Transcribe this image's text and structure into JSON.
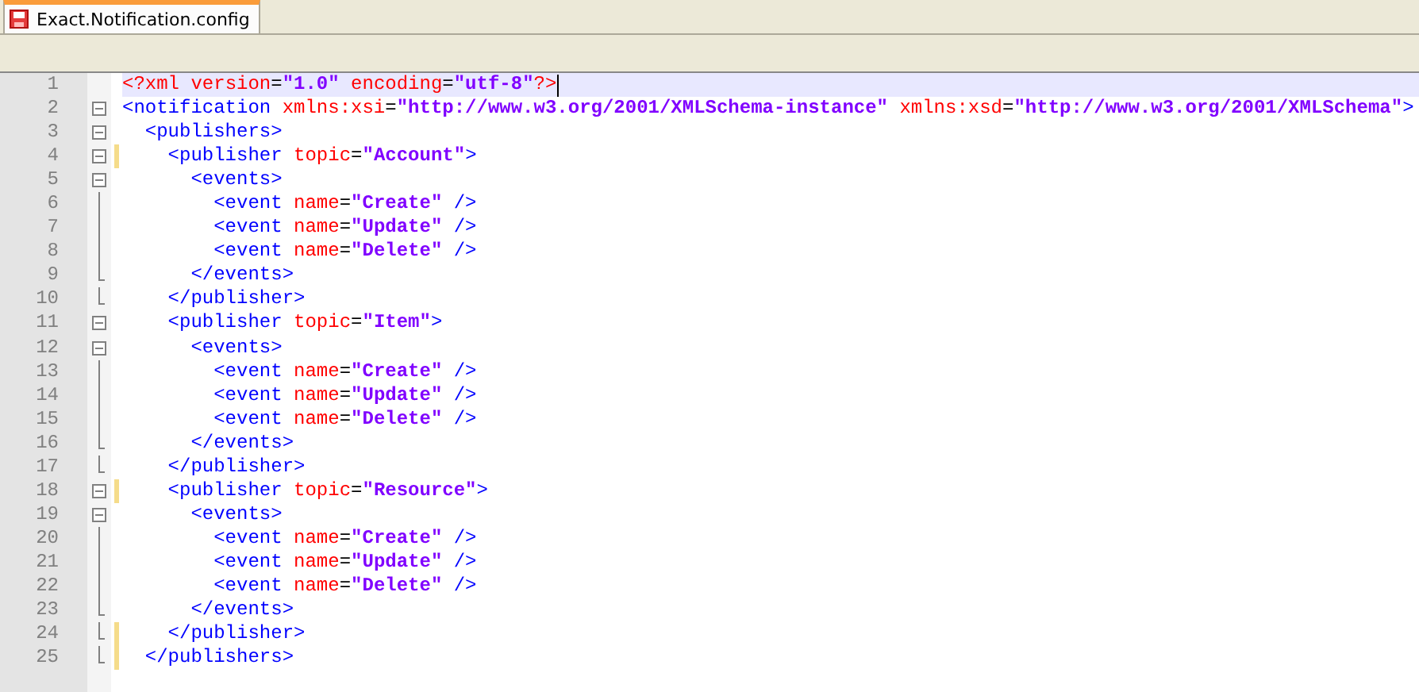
{
  "tabs": [
    {
      "label": "Exact.Notification.config",
      "selected": true
    }
  ],
  "lines": [
    {
      "number": "1",
      "kind": "plain",
      "changed": false,
      "current": true,
      "tokens": [
        {
          "kind": "decl",
          "text": "<?xml"
        },
        {
          "kind": "attr",
          "text": " version"
        },
        {
          "kind": "eq",
          "text": "="
        },
        {
          "kind": "value",
          "text": "\"1.0\""
        },
        {
          "kind": "attr",
          "text": " encoding"
        },
        {
          "kind": "eq",
          "text": "="
        },
        {
          "kind": "value",
          "text": "\"utf-8\""
        },
        {
          "kind": "decl",
          "text": "?>"
        }
      ]
    },
    {
      "number": "2",
      "kind": "fold_open",
      "changed": false,
      "current": false,
      "tokens": [
        {
          "kind": "tag",
          "text": "<notification"
        },
        {
          "kind": "attr",
          "text": " xmlns:xsi"
        },
        {
          "kind": "eq",
          "text": "="
        },
        {
          "kind": "value",
          "text": "\"http://www.w3.org/2001/XMLSchema-instance\""
        },
        {
          "kind": "attr",
          "text": " xmlns:xsd"
        },
        {
          "kind": "eq",
          "text": "="
        },
        {
          "kind": "value",
          "text": "\"http://www.w3.org/2001/XMLSchema\""
        },
        {
          "kind": "tag",
          "text": ">"
        }
      ]
    },
    {
      "number": "3",
      "kind": "fold_open",
      "changed": false,
      "current": false,
      "tokens": [
        {
          "kind": "tag",
          "text": "  <publishers>"
        }
      ]
    },
    {
      "number": "4",
      "kind": "fold_open",
      "changed": true,
      "current": false,
      "tokens": [
        {
          "kind": "tag",
          "text": "    <publisher"
        },
        {
          "kind": "attr",
          "text": " topic"
        },
        {
          "kind": "eq",
          "text": "="
        },
        {
          "kind": "value",
          "text": "\"Account\""
        },
        {
          "kind": "tag",
          "text": ">"
        }
      ]
    },
    {
      "number": "5",
      "kind": "fold_open",
      "changed": false,
      "current": false,
      "tokens": [
        {
          "kind": "tag",
          "text": "      <events>"
        }
      ]
    },
    {
      "number": "6",
      "kind": "fold_body",
      "changed": false,
      "current": false,
      "tokens": [
        {
          "kind": "tag",
          "text": "        <event"
        },
        {
          "kind": "attr",
          "text": " name"
        },
        {
          "kind": "eq",
          "text": "="
        },
        {
          "kind": "value",
          "text": "\"Create\""
        },
        {
          "kind": "tag",
          "text": " />"
        }
      ]
    },
    {
      "number": "7",
      "kind": "fold_body",
      "changed": false,
      "current": false,
      "tokens": [
        {
          "kind": "tag",
          "text": "        <event"
        },
        {
          "kind": "attr",
          "text": " name"
        },
        {
          "kind": "eq",
          "text": "="
        },
        {
          "kind": "value",
          "text": "\"Update\""
        },
        {
          "kind": "tag",
          "text": " />"
        }
      ]
    },
    {
      "number": "8",
      "kind": "fold_body",
      "changed": false,
      "current": false,
      "tokens": [
        {
          "kind": "tag",
          "text": "        <event"
        },
        {
          "kind": "attr",
          "text": " name"
        },
        {
          "kind": "eq",
          "text": "="
        },
        {
          "kind": "value",
          "text": "\"Delete\""
        },
        {
          "kind": "tag",
          "text": " />"
        }
      ]
    },
    {
      "number": "9",
      "kind": "fold_end",
      "changed": false,
      "current": false,
      "tokens": [
        {
          "kind": "tag",
          "text": "      </events>"
        }
      ]
    },
    {
      "number": "10",
      "kind": "fold_end",
      "changed": false,
      "current": false,
      "tokens": [
        {
          "kind": "tag",
          "text": "    </publisher>"
        }
      ]
    },
    {
      "number": "11",
      "kind": "fold_open",
      "changed": false,
      "current": false,
      "tokens": [
        {
          "kind": "tag",
          "text": "    <publisher"
        },
        {
          "kind": "attr",
          "text": " topic"
        },
        {
          "kind": "eq",
          "text": "="
        },
        {
          "kind": "value",
          "text": "\"Item\""
        },
        {
          "kind": "tag",
          "text": ">"
        }
      ]
    },
    {
      "number": "12",
      "kind": "fold_open",
      "changed": false,
      "current": false,
      "tokens": [
        {
          "kind": "tag",
          "text": "      <events>"
        }
      ]
    },
    {
      "number": "13",
      "kind": "fold_body",
      "changed": false,
      "current": false,
      "tokens": [
        {
          "kind": "tag",
          "text": "        <event"
        },
        {
          "kind": "attr",
          "text": " name"
        },
        {
          "kind": "eq",
          "text": "="
        },
        {
          "kind": "value",
          "text": "\"Create\""
        },
        {
          "kind": "tag",
          "text": " />"
        }
      ]
    },
    {
      "number": "14",
      "kind": "fold_body",
      "changed": false,
      "current": false,
      "tokens": [
        {
          "kind": "tag",
          "text": "        <event"
        },
        {
          "kind": "attr",
          "text": " name"
        },
        {
          "kind": "eq",
          "text": "="
        },
        {
          "kind": "value",
          "text": "\"Update\""
        },
        {
          "kind": "tag",
          "text": " />"
        }
      ]
    },
    {
      "number": "15",
      "kind": "fold_body",
      "changed": false,
      "current": false,
      "tokens": [
        {
          "kind": "tag",
          "text": "        <event"
        },
        {
          "kind": "attr",
          "text": " name"
        },
        {
          "kind": "eq",
          "text": "="
        },
        {
          "kind": "value",
          "text": "\"Delete\""
        },
        {
          "kind": "tag",
          "text": " />"
        }
      ]
    },
    {
      "number": "16",
      "kind": "fold_end",
      "changed": false,
      "current": false,
      "tokens": [
        {
          "kind": "tag",
          "text": "      </events>"
        }
      ]
    },
    {
      "number": "17",
      "kind": "fold_end",
      "changed": false,
      "current": false,
      "tokens": [
        {
          "kind": "tag",
          "text": "    </publisher>"
        }
      ]
    },
    {
      "number": "18",
      "kind": "fold_open",
      "changed": true,
      "current": false,
      "tokens": [
        {
          "kind": "tag",
          "text": "    <publisher"
        },
        {
          "kind": "attr",
          "text": " topic"
        },
        {
          "kind": "eq",
          "text": "="
        },
        {
          "kind": "value",
          "text": "\"Resource\""
        },
        {
          "kind": "tag",
          "text": ">"
        }
      ]
    },
    {
      "number": "19",
      "kind": "fold_open",
      "changed": false,
      "current": false,
      "tokens": [
        {
          "kind": "tag",
          "text": "      <events>"
        }
      ]
    },
    {
      "number": "20",
      "kind": "fold_body",
      "changed": false,
      "current": false,
      "tokens": [
        {
          "kind": "tag",
          "text": "        <event"
        },
        {
          "kind": "attr",
          "text": " name"
        },
        {
          "kind": "eq",
          "text": "="
        },
        {
          "kind": "value",
          "text": "\"Create\""
        },
        {
          "kind": "tag",
          "text": " />"
        }
      ]
    },
    {
      "number": "21",
      "kind": "fold_body",
      "changed": false,
      "current": false,
      "tokens": [
        {
          "kind": "tag",
          "text": "        <event"
        },
        {
          "kind": "attr",
          "text": " name"
        },
        {
          "kind": "eq",
          "text": "="
        },
        {
          "kind": "value",
          "text": "\"Update\""
        },
        {
          "kind": "tag",
          "text": " />"
        }
      ]
    },
    {
      "number": "22",
      "kind": "fold_body",
      "changed": false,
      "current": false,
      "tokens": [
        {
          "kind": "tag",
          "text": "        <event"
        },
        {
          "kind": "attr",
          "text": " name"
        },
        {
          "kind": "eq",
          "text": "="
        },
        {
          "kind": "value",
          "text": "\"Delete\""
        },
        {
          "kind": "tag",
          "text": " />"
        }
      ]
    },
    {
      "number": "23",
      "kind": "fold_end",
      "changed": false,
      "current": false,
      "tokens": [
        {
          "kind": "tag",
          "text": "      </events>"
        }
      ]
    },
    {
      "number": "24",
      "kind": "fold_end",
      "changed": true,
      "current": false,
      "tokens": [
        {
          "kind": "tag",
          "text": "    </publisher>"
        }
      ]
    },
    {
      "number": "25",
      "kind": "fold_end",
      "changed": true,
      "current": false,
      "tokens": [
        {
          "kind": "tag",
          "text": "  </publishers>"
        }
      ]
    }
  ]
}
